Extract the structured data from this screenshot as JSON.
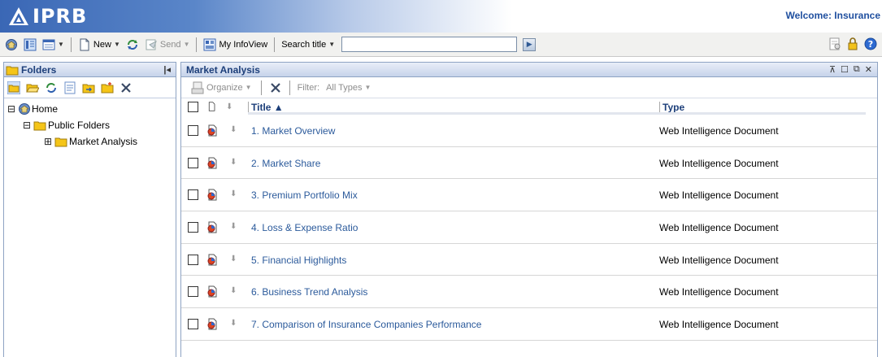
{
  "header": {
    "logo_text": "IPRB",
    "welcome": "Welcome: Insurance"
  },
  "toolbar": {
    "new_label": "New",
    "send_label": "Send",
    "myinfoview_label": "My InfoView",
    "search_mode_label": "Search title",
    "search_value": ""
  },
  "left_panel": {
    "title": "Folders",
    "tree": [
      {
        "label": "Home",
        "toggle": "⊟"
      },
      {
        "label": "Public Folders",
        "toggle": "⊟"
      },
      {
        "label": "Market Analysis",
        "toggle": "⊞"
      }
    ]
  },
  "main_panel": {
    "title": "Market Analysis",
    "organize_label": "Organize",
    "filter_label": "Filter:",
    "filter_value": "All Types",
    "columns": {
      "title": "Title ▲",
      "type": "Type"
    },
    "rows": [
      {
        "title": "1. Market Overview",
        "type": "Web Intelligence Document"
      },
      {
        "title": "2. Market Share",
        "type": "Web Intelligence Document"
      },
      {
        "title": "3. Premium Portfolio Mix",
        "type": "Web Intelligence Document"
      },
      {
        "title": "4. Loss & Expense Ratio",
        "type": "Web Intelligence Document"
      },
      {
        "title": "5. Financial Highlights",
        "type": "Web Intelligence Document"
      },
      {
        "title": "6. Business Trend Analysis",
        "type": "Web Intelligence Document"
      },
      {
        "title": "7. Comparison of Insurance Companies Performance",
        "type": "Web Intelligence Document"
      }
    ]
  },
  "colors": {
    "accent": "#2b5a9b",
    "header_blue": "#3a67b5",
    "folder_yellow": "#f5c518"
  }
}
